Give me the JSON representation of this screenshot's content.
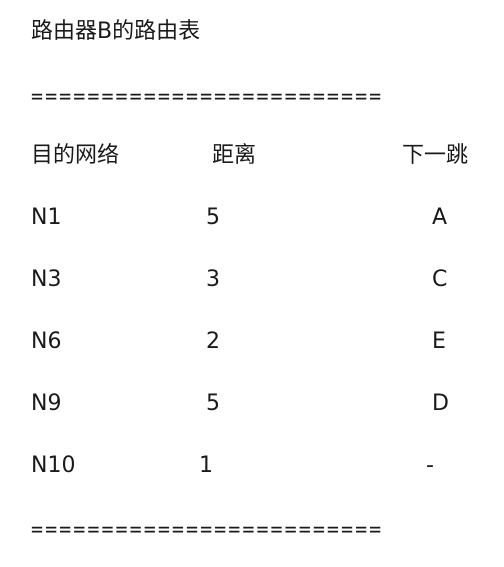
{
  "title": "路由器B的路由表",
  "rule": "=========================",
  "headers": [
    "目的网络",
    "距离",
    "下一跳"
  ],
  "rows": [
    [
      "N1",
      "5",
      "A"
    ],
    [
      "N3",
      "3",
      "C"
    ],
    [
      "N6",
      "2",
      "E"
    ],
    [
      "N9",
      "5",
      "D"
    ],
    [
      "N10",
      "1",
      "-"
    ]
  ]
}
